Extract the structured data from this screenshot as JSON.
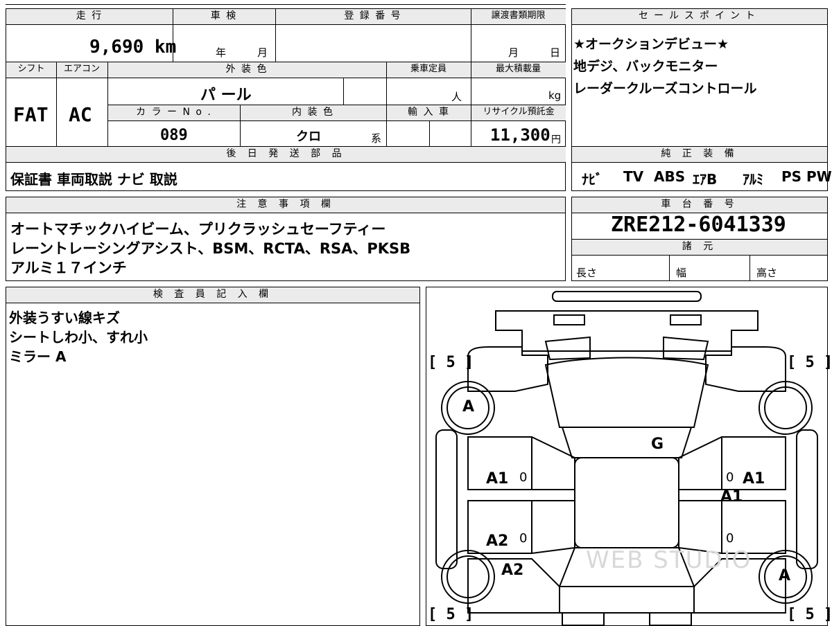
{
  "vehicle": {
    "mileage_header": "走 行",
    "mileage": "9,690 km",
    "inspection_header": "車 検",
    "inspection_year_unit": "年",
    "inspection_month_unit": "月",
    "registration_header": "登 録 番 号",
    "deadline_header": "譲渡書類期限",
    "deadline_month_unit": "月",
    "deadline_day_unit": "日",
    "shift_header": "シフト",
    "shift": "FAT",
    "ac_header": "エアコン",
    "ac": "AC",
    "exterior_color_header": "外 装 色",
    "exterior_color": "パ ール",
    "capacity_header": "乗車定員",
    "capacity_unit": "人",
    "max_load_header": "最大積載量",
    "max_load_unit": "kg",
    "color_no_header": "カ ラ ー N o .",
    "color_no": "089",
    "interior_color_header": "内 装 色",
    "interior_color": "クロ",
    "interior_suffix": "系",
    "import_header": "輸 入 車",
    "recycle_header": "リサイクル預託金",
    "recycle_fee": "11,300",
    "recycle_unit": "円"
  },
  "sales_points": {
    "header": "セールスポイント",
    "lines": [
      "★オークションデビュー★",
      "地デジ、バックモニター",
      "レーダークルーズコントロール"
    ]
  },
  "later_parts": {
    "header": "後 日 発 送 部 品",
    "value": "保証書 車両取説 ナビ 取説"
  },
  "genuine_equipment": {
    "header": "純 正 装 備",
    "items": [
      "ﾅﾋﾞ",
      "TV",
      "ABS",
      "ｴｱB",
      "ｱﾙﾐ",
      "PS",
      "PW"
    ]
  },
  "notes": {
    "header": "注 意 事 項 欄",
    "lines": [
      "オートマチックハイビーム、プリクラッシュセーフティー",
      "レーントレーシングアシスト、BSM、RCTA、RSA、PKSB",
      "アルミ１７インチ"
    ]
  },
  "chassis": {
    "header": "車 台 番 号",
    "number": "ZRE212-6041339",
    "spec_header": "諸 元",
    "length_label": "長さ",
    "width_label": "幅",
    "height_label": "高さ"
  },
  "inspector": {
    "header": "検 査 員 記 入 欄",
    "lines": [
      "外装うすい線キズ",
      "シートしわ小、すれ小",
      "ミラー A"
    ]
  },
  "diagram": {
    "tire_fl": "[ 5 ]",
    "tire_fr": "[ 5 ]",
    "tire_rl": "[ 5 ]",
    "tire_rr": "[ 5 ]",
    "mark_front_left_wheel": "A",
    "mark_rear_right_wheel": "A",
    "mark_windshield": "G",
    "mark_left_front_door": "A1",
    "mark_right_front_door": "A1",
    "mark_right_pillar": "A1",
    "mark_left_rear_door": "A2",
    "mark_left_rear_fender": "A2",
    "door_zero_lf": "0",
    "door_zero_rf": "0",
    "door_zero_lr": "0",
    "door_zero_rr": "0",
    "watermark": "WEB STUDIO"
  }
}
